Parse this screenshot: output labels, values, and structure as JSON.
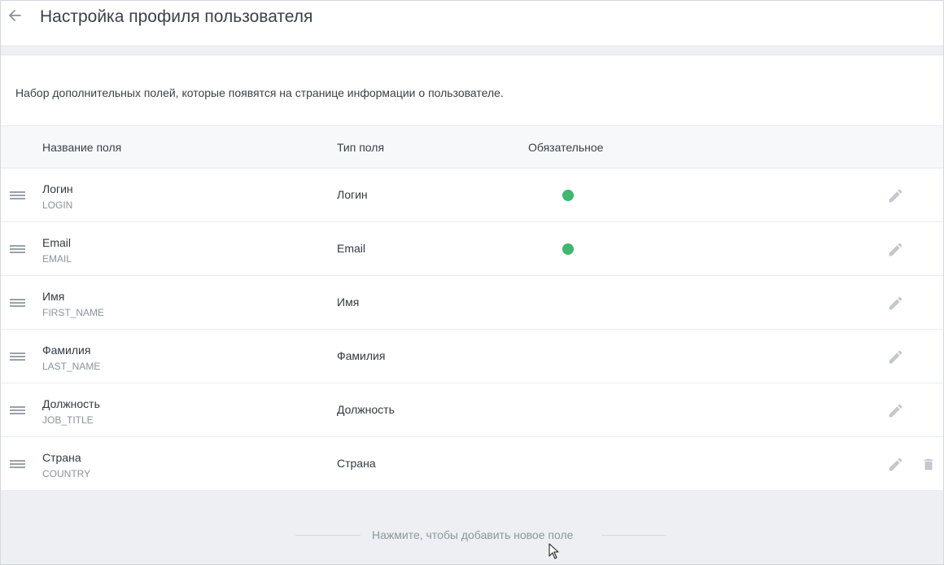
{
  "header": {
    "back_icon": "arrow-left-icon",
    "title": "Настройка профиля пользователя"
  },
  "description": "Набор дополнительных полей, которые появятся на странице информации о пользователе.",
  "table": {
    "columns": {
      "name": "Название поля",
      "type": "Тип поля",
      "required": "Обязательное"
    },
    "rows": [
      {
        "name": "Логин",
        "code": "LOGIN",
        "type": "Логин",
        "required": true,
        "deletable": false
      },
      {
        "name": "Email",
        "code": "EMAIL",
        "type": "Email",
        "required": true,
        "deletable": false
      },
      {
        "name": "Имя",
        "code": "FIRST_NAME",
        "type": "Имя",
        "required": false,
        "deletable": false
      },
      {
        "name": "Фамилия",
        "code": "LAST_NAME",
        "type": "Фамилия",
        "required": false,
        "deletable": false
      },
      {
        "name": "Должность",
        "code": "JOB_TITLE",
        "type": "Должность",
        "required": false,
        "deletable": false
      },
      {
        "name": "Страна",
        "code": "COUNTRY",
        "type": "Страна",
        "required": false,
        "deletable": true
      }
    ]
  },
  "footer": {
    "add_field_label": "Нажмите, чтобы добавить новое поле"
  },
  "colors": {
    "required_dot": "#3fb76e",
    "icon_gray": "#c3c8ce",
    "footer_bg": "#eeeff2"
  }
}
